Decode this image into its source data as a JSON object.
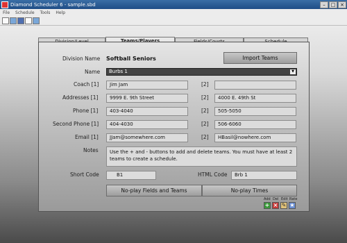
{
  "window": {
    "title": "Diamond Scheduler 6 - sample.sbd"
  },
  "menu": [
    "File",
    "Schedule",
    "Tools",
    "Help"
  ],
  "tabs": [
    "Division/Level",
    "Teams/Players",
    "Fields/Courts",
    "Schedule"
  ],
  "division": {
    "label": "Division Name",
    "value": "Softball Seniors"
  },
  "import_button": "Import Teams",
  "name": {
    "label": "Name",
    "value": "Burbs 1"
  },
  "coach": {
    "label": "Coach [1]",
    "value1": "Jim Jam",
    "label2": "[2]",
    "value2": ""
  },
  "addresses": {
    "label": "Addresses [1]",
    "value1": "9999 E. 9th Street",
    "label2": "[2]",
    "value2": "4000 E. 49th St"
  },
  "phone": {
    "label": "Phone [1]",
    "value1": "403-4040",
    "label2": "[2]",
    "value2": "505-5050"
  },
  "second_phone": {
    "label": "Second Phone [1]",
    "value1": "404-4030",
    "label2": "[2]",
    "value2": "506-6060"
  },
  "email": {
    "label": "Email [1]",
    "value1": "JJam@somewhere.com",
    "label2": "[2]",
    "value2": "HBasil@nowhere.com"
  },
  "notes": {
    "label": "Notes",
    "value": "Use the + and - buttons to add and delete teams. You must have at least 2 teams to create a schedule."
  },
  "short_code": {
    "label": "Short Code",
    "value": "B1"
  },
  "html_code": {
    "label": "HTML Code",
    "value": "Brb 1"
  },
  "bottom_buttons": {
    "no_play_fields": "No-play Fields and Teams",
    "no_play_times": "No-play Times"
  },
  "mini_labels": [
    "Add",
    "Del",
    "Edit",
    "Rate"
  ]
}
